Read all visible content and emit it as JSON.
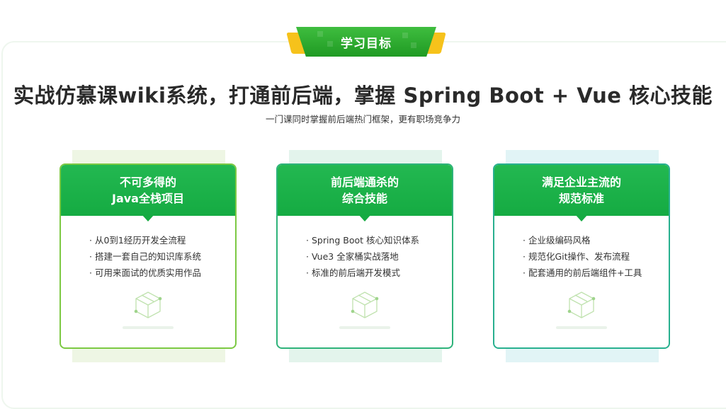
{
  "badge": {
    "label": "学习目标"
  },
  "headline": "实战仿慕课wiki系统，打通前后端，掌握 Spring Boot + Vue 核心技能",
  "subline": "一门课同时掌握前后端热门框架，更有职场竞争力",
  "colors": {
    "primary_green": "#1db14a",
    "badge_green": "#2aa82e",
    "badge_wing": "#f6c21b",
    "card1_border": "#7cc943",
    "card2_border": "#2eb37a",
    "card3_border": "#28b08f",
    "card1_back": "#eef6e4",
    "card2_back": "#e3f4ec",
    "card3_back": "#e1f4f6"
  },
  "cards": [
    {
      "title_line1": "不可多得的",
      "title_line2": "Java全栈项目",
      "items": [
        "· 从0到1经历开发全流程",
        "· 搭建一套自己的知识库系统",
        "· 可用来面试的优质实用作品"
      ],
      "icon": "cube-icon"
    },
    {
      "title_line1": "前后端通杀的",
      "title_line2": "综合技能",
      "items": [
        "· Spring Boot 核心知识体系",
        "· Vue3 全家桶实战落地",
        "· 标准的前后端开发模式"
      ],
      "icon": "cube-icon"
    },
    {
      "title_line1": "满足企业主流的",
      "title_line2": "规范标准",
      "items": [
        "· 企业级编码风格",
        "· 规范化Git操作、发布流程",
        "· 配套通用的前后端组件+工具"
      ],
      "icon": "cube-icon"
    }
  ]
}
